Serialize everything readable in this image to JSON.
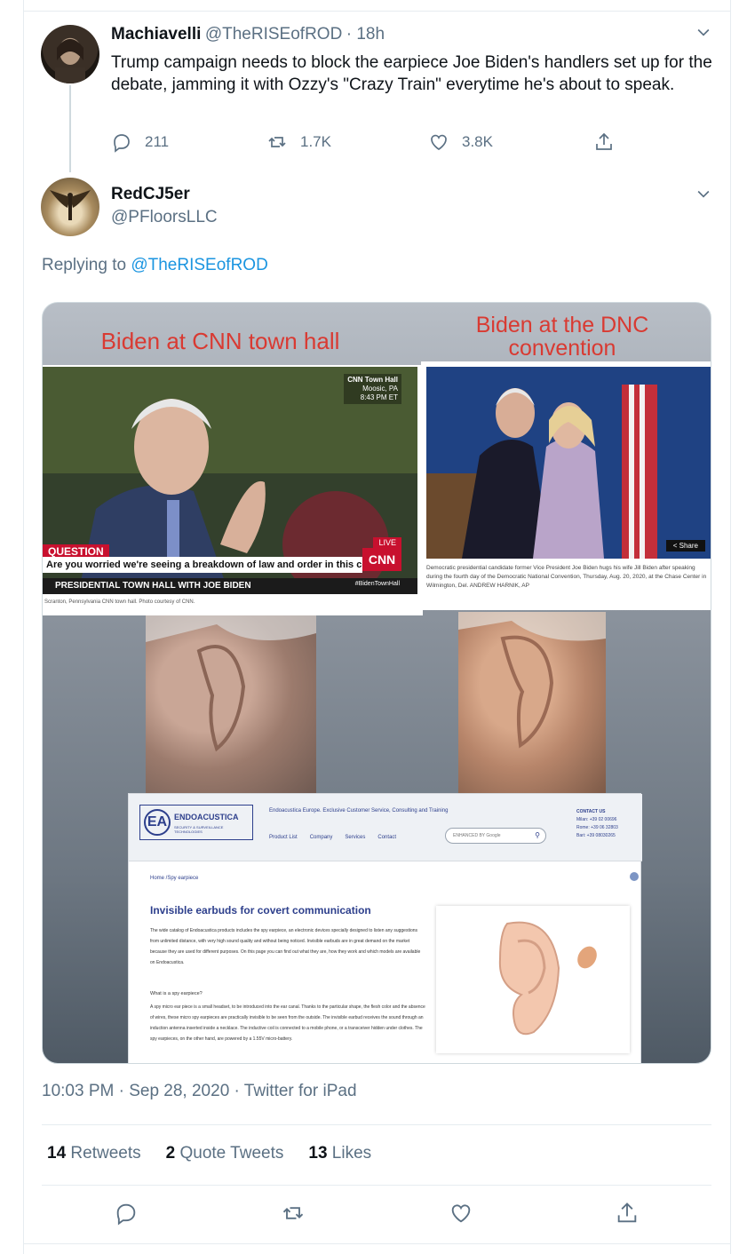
{
  "parent_tweet": {
    "name": "Machiavelli",
    "handle": "@TheRISEofROD",
    "time": "· 18h",
    "text": "Trump campaign needs to block the earpiece Joe Biden's handlers set up for the debate, jamming it with Ozzy's \"Crazy Train\" everytime he's about to speak.",
    "replies": "211",
    "retweets": "1.7K",
    "likes": "3.8K"
  },
  "main_tweet": {
    "name": "RedCJ5er",
    "handle": "@PFloorsLLC",
    "replying_prefix": "Replying to",
    "replying_to": "@TheRISEofROD",
    "timestamp": "10:03 PM · Sep 28, 2020 · Twitter for iPad",
    "retweets_count": "14",
    "retweets_label": "Retweets",
    "quote_count": "2",
    "quote_label": "Quote Tweets",
    "likes_count": "13",
    "likes_label": "Likes"
  },
  "media": {
    "title_left": "Biden at CNN town hall",
    "title_right_line1": "Biden at the DNC",
    "title_right_line2": "convention",
    "cnn_badge": "CNN Town Hall",
    "cnn_location": "Moosic, PA",
    "cnn_time": "8:43 PM ET",
    "question_tag": "QUESTION",
    "question_text": "Are you worried we're seeing a breakdown of law and order in this country?",
    "banner_text": "PRESIDENTIAL TOWN HALL WITH JOE BIDEN",
    "hashtag": "#BidenTownHall",
    "live": "LIVE",
    "cnn_logo": "CNN",
    "cnn_caption": "Scranton, Pennsylvania CNN town hall. Photo courtesy of CNN.",
    "share": "Share",
    "dnc_caption": "Democratic presidential candidate former Vice President Joe Biden hugs his wife Jill Biden after speaking during the fourth day of the Democratic National Convention, Thursday, Aug. 20, 2020, at the Chase Center in Wilmington, Del. ANDREW HARNIK, AP",
    "site_brand": "ENDOACUSTICA",
    "site_brand_sub": "SECURITY & SURVEILLANCE TECHNOLOGIES",
    "site_tagline": "Endoacustica Europe. Exclusive Customer Service, Consulting and Training",
    "site_nav": [
      "Product List",
      "Company",
      "Services",
      "Contact"
    ],
    "site_search": "ENHANCED BY Google",
    "site_contact_title": "CONTACT US",
    "site_contact_lines": [
      "Milan: +39 02 00696",
      "Rome: +39 06 32803",
      "Bari: +39 08030265"
    ],
    "site_breadcrumb": "Home /Spy earpiece",
    "site_heading": "Invisible earbuds for covert communication",
    "site_para1": "The wide catalog of Endoacustica products includes the spy earpiece, an electronic devices specially designed to listen any suggestions from unlimited distance, with very high sound quality and without being noticed. Invisible earbuds are in great demand on the market because they are used for different purposes. On this page you can find out what they are, how they work and which models are available on Endoacustica.",
    "site_subheading": "What is a spy earpiece?",
    "site_para2": "A spy micro ear piece is a small headset, to be introduced into the ear canal. Thanks to the particular shape, the flesh color and the absence of wires, these micro spy earpieces are practically invisible to be seen from the outside. The invisible earbud receives the sound through an induction antenna inserted inside a necklace. The inductive coil is connected to a mobile phone, or a transceiver hidden under clothes. The spy earpieces, on the other hand, are powered by a 1.55V micro-battery."
  },
  "colors": {
    "link": "#1b95e0",
    "muted": "#5b7083",
    "title_red": "#d93a32"
  },
  "icons": [
    "reply-icon",
    "retweet-icon",
    "like-icon",
    "share-icon",
    "chevron-down-icon"
  ]
}
